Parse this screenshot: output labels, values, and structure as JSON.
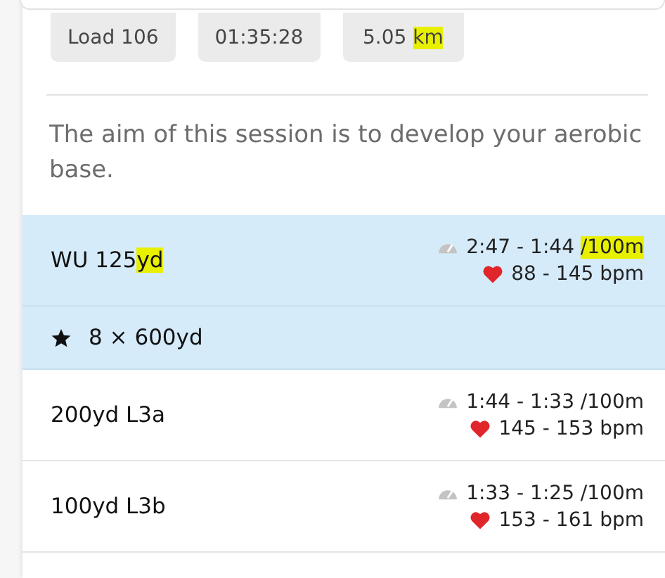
{
  "stats": [
    [
      {
        "text": "Load 106"
      }
    ],
    [
      {
        "text": "01:35:28"
      }
    ],
    [
      {
        "text": "5.05 "
      },
      {
        "text": "km",
        "highlighted": true
      }
    ]
  ],
  "description": "The aim of this session is to develop your aerobic base.",
  "steps": [
    {
      "kind": "interval",
      "selected": true,
      "label": [
        {
          "text": "WU 125"
        },
        {
          "text": "yd",
          "highlighted": true
        }
      ],
      "pace": [
        {
          "text": "2:47 - 1:44 "
        },
        {
          "text": "/100m",
          "highlighted": true
        }
      ],
      "heart_rate": "88 - 145 bpm"
    },
    {
      "kind": "set",
      "selected": true,
      "label": [
        {
          "text": "8 × 600yd"
        }
      ]
    },
    {
      "kind": "interval",
      "selected": false,
      "label": [
        {
          "text": "200yd L3a"
        }
      ],
      "pace": [
        {
          "text": "1:44 - 1:33 /100m"
        }
      ],
      "heart_rate": "145 - 153 bpm"
    },
    {
      "kind": "interval",
      "selected": false,
      "label": [
        {
          "text": "100yd L3b"
        }
      ],
      "pace": [
        {
          "text": "1:33 - 1:25 /100m"
        }
      ],
      "heart_rate": "153 - 161 bpm"
    }
  ]
}
